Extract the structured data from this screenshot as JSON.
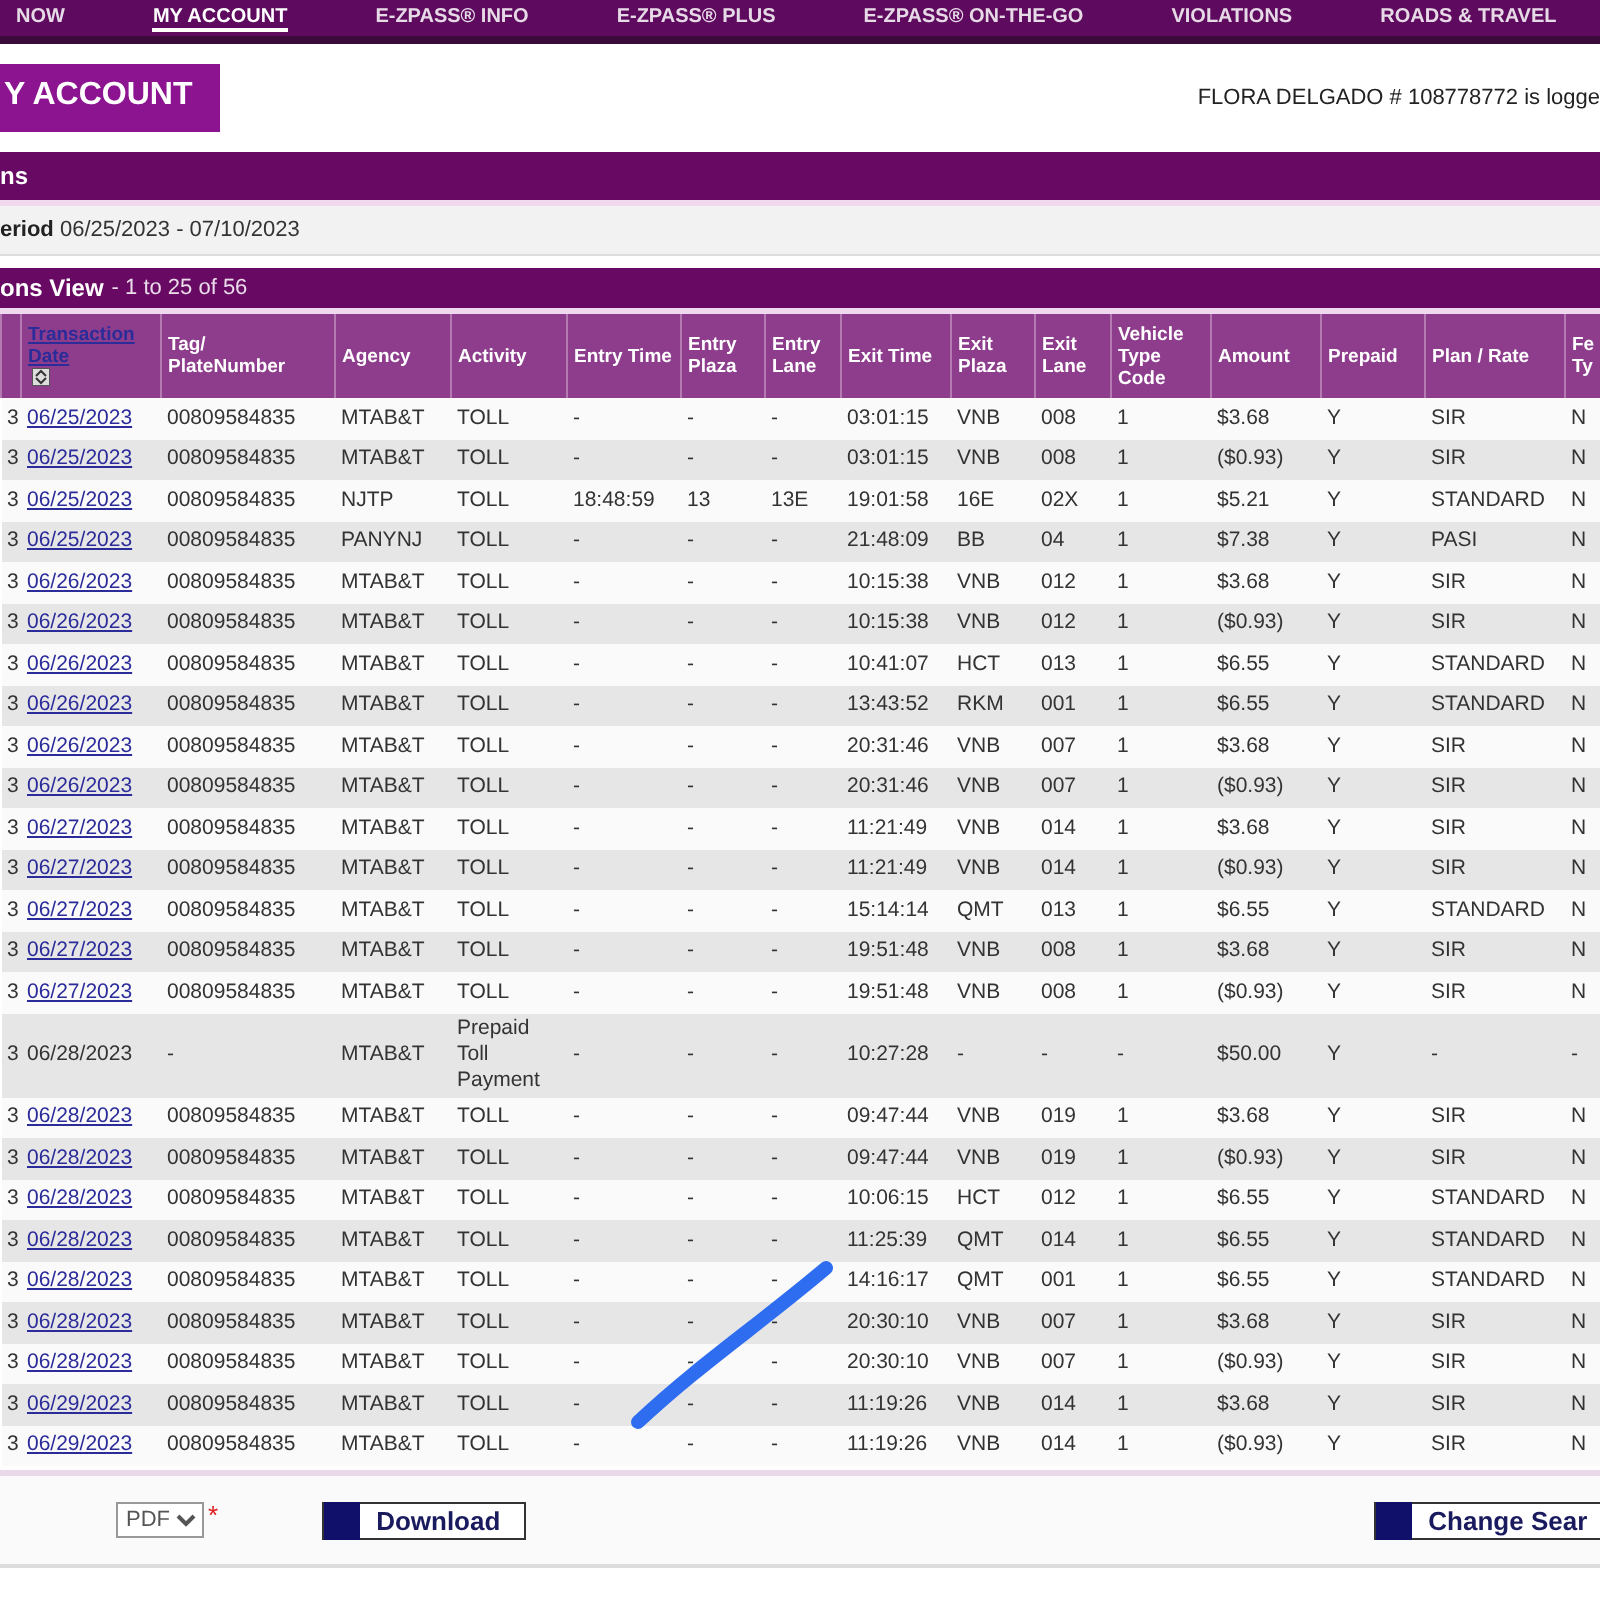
{
  "nav": {
    "items": [
      {
        "label": "NOW",
        "selected": false
      },
      {
        "label": "MY ACCOUNT",
        "selected": true
      },
      {
        "label": "E-ZPASS® INFO",
        "selected": false
      },
      {
        "label": "E-ZPASS® PLUS",
        "selected": false
      },
      {
        "label": "E-ZPASS® ON-THE-GO",
        "selected": false
      },
      {
        "label": "VIOLATIONS",
        "selected": false
      },
      {
        "label": "ROADS & TRAVEL",
        "selected": false
      }
    ]
  },
  "header": {
    "title_button": "Y ACCOUNT",
    "user_status": "FLORA DELGADO # 108778772 is logge"
  },
  "section_title": "ns",
  "period": {
    "label": "eriod",
    "value": "06/25/2023 - 07/10/2023"
  },
  "view_bar": {
    "title": "ons View",
    "count": "- 1 to 25 of 56"
  },
  "table": {
    "columns": [
      "",
      "Transaction Date",
      "Tag/ PlateNumber",
      "Agency",
      "Activity",
      "Entry Time",
      "Entry Plaza",
      "Entry Lane",
      "Exit Time",
      "Exit Plaza",
      "Exit Lane",
      "Vehicle Type Code",
      "Amount",
      "Prepaid",
      "Plan / Rate",
      "Fe Ty"
    ],
    "rows": [
      {
        "date_is_link": true,
        "cells": [
          "3",
          "06/25/2023",
          "00809584835",
          "MTAB&T",
          "TOLL",
          "-",
          "-",
          "-",
          "03:01:15",
          "VNB",
          "008",
          "1",
          "$3.68",
          "Y",
          "SIR",
          "N"
        ]
      },
      {
        "date_is_link": true,
        "cells": [
          "3",
          "06/25/2023",
          "00809584835",
          "MTAB&T",
          "TOLL",
          "-",
          "-",
          "-",
          "03:01:15",
          "VNB",
          "008",
          "1",
          "($0.93)",
          "Y",
          "SIR",
          "N"
        ]
      },
      {
        "date_is_link": true,
        "cells": [
          "3",
          "06/25/2023",
          "00809584835",
          "NJTP",
          "TOLL",
          "18:48:59",
          "13",
          "13E",
          "19:01:58",
          "16E",
          "02X",
          "1",
          "$5.21",
          "Y",
          "STANDARD",
          "N"
        ]
      },
      {
        "date_is_link": true,
        "cells": [
          "3",
          "06/25/2023",
          "00809584835",
          "PANYNJ",
          "TOLL",
          "-",
          "-",
          "-",
          "21:48:09",
          "BB",
          "04",
          "1",
          "$7.38",
          "Y",
          "PASI",
          "N"
        ]
      },
      {
        "date_is_link": true,
        "cells": [
          "3",
          "06/26/2023",
          "00809584835",
          "MTAB&T",
          "TOLL",
          "-",
          "-",
          "-",
          "10:15:38",
          "VNB",
          "012",
          "1",
          "$3.68",
          "Y",
          "SIR",
          "N"
        ]
      },
      {
        "date_is_link": true,
        "cells": [
          "3",
          "06/26/2023",
          "00809584835",
          "MTAB&T",
          "TOLL",
          "-",
          "-",
          "-",
          "10:15:38",
          "VNB",
          "012",
          "1",
          "($0.93)",
          "Y",
          "SIR",
          "N"
        ]
      },
      {
        "date_is_link": true,
        "cells": [
          "3",
          "06/26/2023",
          "00809584835",
          "MTAB&T",
          "TOLL",
          "-",
          "-",
          "-",
          "10:41:07",
          "HCT",
          "013",
          "1",
          "$6.55",
          "Y",
          "STANDARD",
          "N"
        ]
      },
      {
        "date_is_link": true,
        "cells": [
          "3",
          "06/26/2023",
          "00809584835",
          "MTAB&T",
          "TOLL",
          "-",
          "-",
          "-",
          "13:43:52",
          "RKM",
          "001",
          "1",
          "$6.55",
          "Y",
          "STANDARD",
          "N"
        ]
      },
      {
        "date_is_link": true,
        "cells": [
          "3",
          "06/26/2023",
          "00809584835",
          "MTAB&T",
          "TOLL",
          "-",
          "-",
          "-",
          "20:31:46",
          "VNB",
          "007",
          "1",
          "$3.68",
          "Y",
          "SIR",
          "N"
        ]
      },
      {
        "date_is_link": true,
        "cells": [
          "3",
          "06/26/2023",
          "00809584835",
          "MTAB&T",
          "TOLL",
          "-",
          "-",
          "-",
          "20:31:46",
          "VNB",
          "007",
          "1",
          "($0.93)",
          "Y",
          "SIR",
          "N"
        ]
      },
      {
        "date_is_link": true,
        "cells": [
          "3",
          "06/27/2023",
          "00809584835",
          "MTAB&T",
          "TOLL",
          "-",
          "-",
          "-",
          "11:21:49",
          "VNB",
          "014",
          "1",
          "$3.68",
          "Y",
          "SIR",
          "N"
        ]
      },
      {
        "date_is_link": true,
        "cells": [
          "3",
          "06/27/2023",
          "00809584835",
          "MTAB&T",
          "TOLL",
          "-",
          "-",
          "-",
          "11:21:49",
          "VNB",
          "014",
          "1",
          "($0.93)",
          "Y",
          "SIR",
          "N"
        ]
      },
      {
        "date_is_link": true,
        "cells": [
          "3",
          "06/27/2023",
          "00809584835",
          "MTAB&T",
          "TOLL",
          "-",
          "-",
          "-",
          "15:14:14",
          "QMT",
          "013",
          "1",
          "$6.55",
          "Y",
          "STANDARD",
          "N"
        ]
      },
      {
        "date_is_link": true,
        "cells": [
          "3",
          "06/27/2023",
          "00809584835",
          "MTAB&T",
          "TOLL",
          "-",
          "-",
          "-",
          "19:51:48",
          "VNB",
          "008",
          "1",
          "$3.68",
          "Y",
          "SIR",
          "N"
        ]
      },
      {
        "date_is_link": true,
        "cells": [
          "3",
          "06/27/2023",
          "00809584835",
          "MTAB&T",
          "TOLL",
          "-",
          "-",
          "-",
          "19:51:48",
          "VNB",
          "008",
          "1",
          "($0.93)",
          "Y",
          "SIR",
          "N"
        ]
      },
      {
        "date_is_link": false,
        "cells": [
          "3",
          "06/28/2023",
          "-",
          "MTAB&T",
          "Prepaid Toll Payment",
          "-",
          "-",
          "-",
          "10:27:28",
          "-",
          "-",
          "-",
          "$50.00",
          "Y",
          "-",
          "-"
        ]
      },
      {
        "date_is_link": true,
        "cells": [
          "3",
          "06/28/2023",
          "00809584835",
          "MTAB&T",
          "TOLL",
          "-",
          "-",
          "-",
          "09:47:44",
          "VNB",
          "019",
          "1",
          "$3.68",
          "Y",
          "SIR",
          "N"
        ]
      },
      {
        "date_is_link": true,
        "cells": [
          "3",
          "06/28/2023",
          "00809584835",
          "MTAB&T",
          "TOLL",
          "-",
          "-",
          "-",
          "09:47:44",
          "VNB",
          "019",
          "1",
          "($0.93)",
          "Y",
          "SIR",
          "N"
        ]
      },
      {
        "date_is_link": true,
        "cells": [
          "3",
          "06/28/2023",
          "00809584835",
          "MTAB&T",
          "TOLL",
          "-",
          "-",
          "-",
          "10:06:15",
          "HCT",
          "012",
          "1",
          "$6.55",
          "Y",
          "STANDARD",
          "N"
        ]
      },
      {
        "date_is_link": true,
        "cells": [
          "3",
          "06/28/2023",
          "00809584835",
          "MTAB&T",
          "TOLL",
          "-",
          "-",
          "-",
          "11:25:39",
          "QMT",
          "014",
          "1",
          "$6.55",
          "Y",
          "STANDARD",
          "N"
        ]
      },
      {
        "date_is_link": true,
        "cells": [
          "3",
          "06/28/2023",
          "00809584835",
          "MTAB&T",
          "TOLL",
          "-",
          "-",
          "-",
          "14:16:17",
          "QMT",
          "001",
          "1",
          "$6.55",
          "Y",
          "STANDARD",
          "N"
        ]
      },
      {
        "date_is_link": true,
        "cells": [
          "3",
          "06/28/2023",
          "00809584835",
          "MTAB&T",
          "TOLL",
          "-",
          "-",
          "-",
          "20:30:10",
          "VNB",
          "007",
          "1",
          "$3.68",
          "Y",
          "SIR",
          "N"
        ]
      },
      {
        "date_is_link": true,
        "cells": [
          "3",
          "06/28/2023",
          "00809584835",
          "MTAB&T",
          "TOLL",
          "-",
          "-",
          "-",
          "20:30:10",
          "VNB",
          "007",
          "1",
          "($0.93)",
          "Y",
          "SIR",
          "N"
        ]
      },
      {
        "date_is_link": true,
        "cells": [
          "3",
          "06/29/2023",
          "00809584835",
          "MTAB&T",
          "TOLL",
          "-",
          "-",
          "-",
          "11:19:26",
          "VNB",
          "014",
          "1",
          "$3.68",
          "Y",
          "SIR",
          "N"
        ]
      },
      {
        "date_is_link": true,
        "cells": [
          "3",
          "06/29/2023",
          "00809584835",
          "MTAB&T",
          "TOLL",
          "-",
          "-",
          "-",
          "11:19:26",
          "VNB",
          "014",
          "1",
          "($0.93)",
          "Y",
          "SIR",
          "N"
        ]
      }
    ]
  },
  "footer": {
    "format_select": "PDF",
    "required_mark": "*",
    "download_button": "Download",
    "change_search_button": "Change Sear"
  }
}
